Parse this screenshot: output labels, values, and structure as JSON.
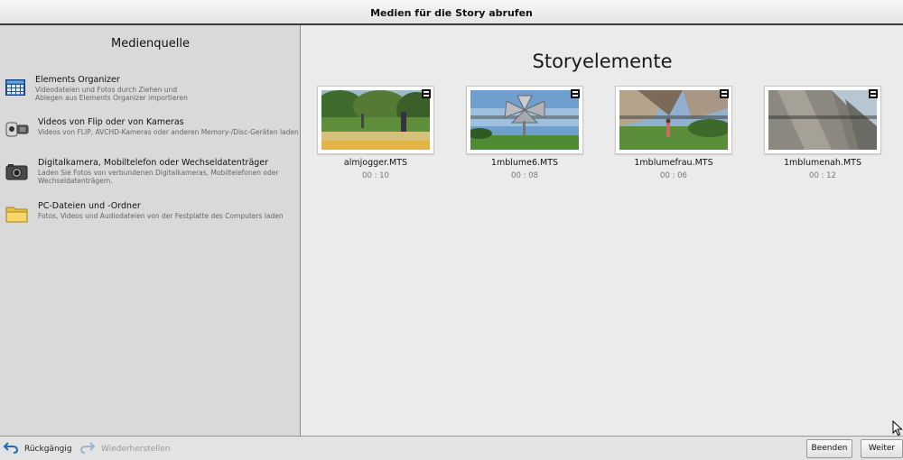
{
  "window": {
    "title": "Medien für die Story abrufen"
  },
  "sidebar": {
    "heading": "Medienquelle",
    "sources": [
      {
        "icon": "organizer-grid-icon",
        "title": "Elements Organizer",
        "description": "Videodateien und Fotos durch Ziehen und Ablegen aus Elements Organizer importieren"
      },
      {
        "icon": "flip-camera-icon",
        "title": "Videos von Flip oder von Kameras",
        "description": "Videos von FLIP, AVCHD-Kameras oder anderen Memory-/Disc-Geräten laden"
      },
      {
        "icon": "photo-camera-icon",
        "title": "Digitalkamera, Mobiltelefon oder Wechseldatenträger",
        "description": "Laden Sie Fotos von verbundenen Digitalkameras, Mobiltelefonen oder Wechseldatenträgern."
      },
      {
        "icon": "folder-icon",
        "title": "PC-Dateien und -Ordner",
        "description": "Fotos, Videos und Audiodateien von der Festplatte des Computers laden"
      }
    ]
  },
  "main": {
    "heading": "Storyelemente",
    "items": [
      {
        "name": "almjogger.MTS",
        "duration": "00 : 10",
        "thumbnail": "park-jogger-thumbnail"
      },
      {
        "name": "1mblume6.MTS",
        "duration": "00 : 08",
        "thumbnail": "flower-sculpture-thumbnail"
      },
      {
        "name": "1mblumefrau.MTS",
        "duration": "00 : 06",
        "thumbnail": "sculpture-woman-thumbnail"
      },
      {
        "name": "1mblumenah.MTS",
        "duration": "00 : 12",
        "thumbnail": "sculpture-closeup-thumbnail"
      }
    ]
  },
  "footer": {
    "undo_label": "Rückgängig",
    "redo_label": "Wiederherstellen",
    "finish_label": "Beenden",
    "next_label": "Weiter"
  },
  "colors": {
    "accent": "#1c6fb5",
    "sidebar_bg": "#d9d9d9",
    "main_bg": "#ebebeb"
  }
}
